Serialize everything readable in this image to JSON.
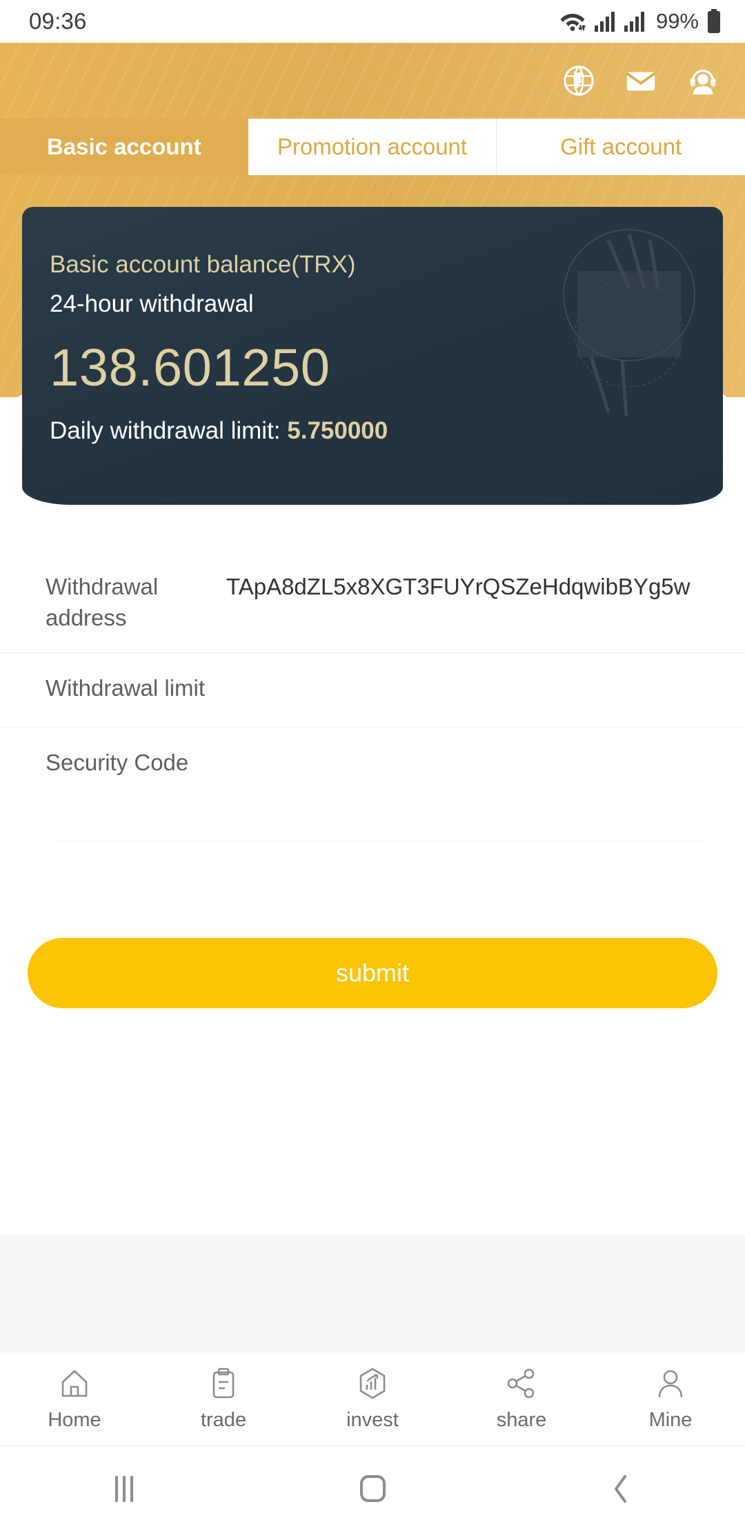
{
  "statusbar": {
    "time": "09:36",
    "battery_percent": "99%",
    "icons": [
      "wifi-icon",
      "signal-icon",
      "signal-icon",
      "battery-icon"
    ]
  },
  "header": {
    "icons": [
      {
        "name": "globe-icon",
        "label": "language"
      },
      {
        "name": "envelope-icon",
        "label": "messages"
      },
      {
        "name": "headset-icon",
        "label": "support"
      }
    ]
  },
  "tabs": [
    {
      "label": "Basic account",
      "active": true
    },
    {
      "label": "Promotion account",
      "active": false
    },
    {
      "label": "Gift account",
      "active": false
    }
  ],
  "balance_card": {
    "title": "Basic account balance(TRX)",
    "subtitle": "24-hour withdrawal",
    "amount": "138.601250",
    "limit_label": "Daily withdrawal limit: ",
    "limit_value": "5.750000"
  },
  "form": {
    "fields": [
      {
        "label": "Withdrawal address",
        "value": "TApA8dZL5x8XGT3FUYrQSZeHdqwibBYg5w",
        "type": "static",
        "placeholder": ""
      },
      {
        "label": "Withdrawal limit",
        "value": "",
        "type": "input",
        "placeholder": ""
      },
      {
        "label": "Security Code",
        "value": "",
        "type": "input",
        "placeholder": ""
      }
    ],
    "submit_label": "submit"
  },
  "bottom_nav": [
    {
      "label": "Home",
      "icon": "home-icon"
    },
    {
      "label": "trade",
      "icon": "clipboard-icon"
    },
    {
      "label": "invest",
      "icon": "chart-hexagon-icon"
    },
    {
      "label": "share",
      "icon": "share-nodes-icon"
    },
    {
      "label": "Mine",
      "icon": "person-icon"
    }
  ],
  "android_nav": [
    {
      "name": "recents-button"
    },
    {
      "name": "home-button"
    },
    {
      "name": "back-button"
    }
  ],
  "colors": {
    "gold": "#e0ad50",
    "gold_text": "#dda93f",
    "card_bg": "#243340",
    "card_accent": "#ddd0a4",
    "submit": "#fbc404"
  }
}
